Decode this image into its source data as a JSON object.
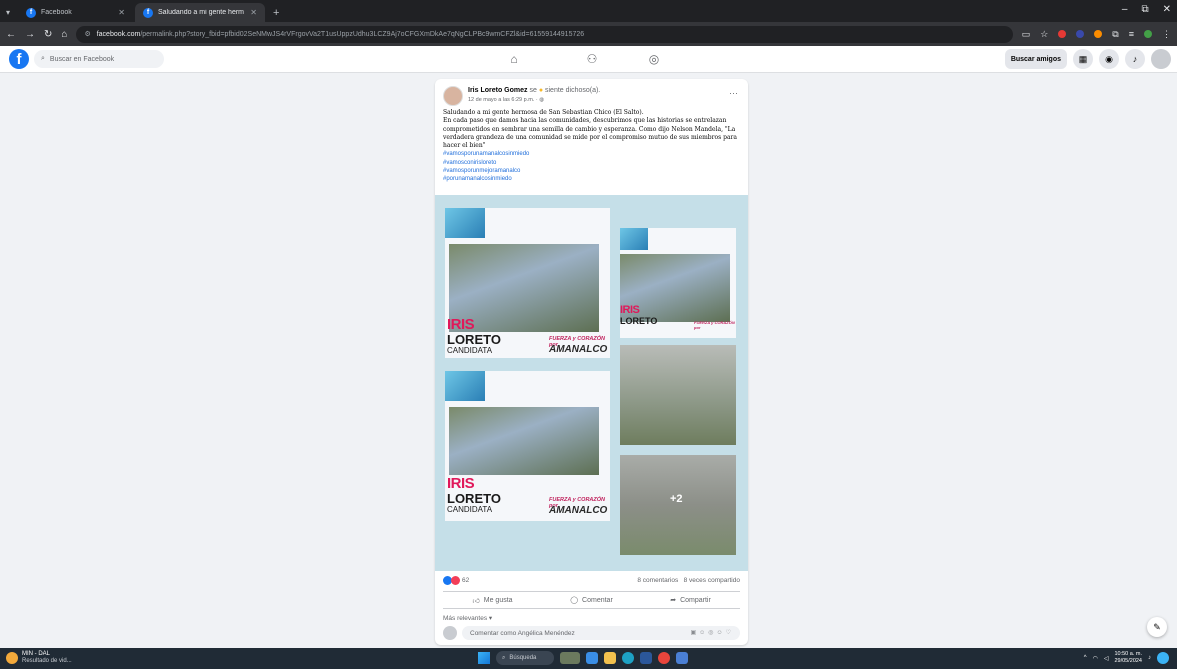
{
  "browser": {
    "tabs": [
      {
        "title": "Facebook",
        "active": false
      },
      {
        "title": "Saludando a mi gente herm",
        "active": true
      }
    ],
    "new_tab": "+",
    "url_host": "facebook.com",
    "url_path": "/permalink.php?story_fbid=pfbid02SeNMwJS4rVFrgovVa2T1usUppzUdhu3LCZ9Aj7oCFGXmDkAe7qNgCLPBc9wmCFZl&id=61559144915726",
    "window_controls": [
      "–",
      "⧉",
      "✕"
    ]
  },
  "facebook": {
    "logo": "f",
    "search_placeholder": "Buscar en Facebook",
    "nav_icons": [
      "home-icon",
      "friends-icon",
      "groups-icon"
    ],
    "find_friends": "Buscar amigos"
  },
  "post": {
    "author": "Iris Loreto Gomez",
    "feeling_prefix": " se ",
    "feeling": "siente dichoso(a).",
    "date": "12 de mayo a las 6:29 p.m. · ",
    "body": "Saludando a mi gente hermosa de San Sebastian Chico (El Salto).\nEn cada paso que damos hacia las comunidades, descubrimos que las historias se entrelazan comprometidos en sembrar una semilla de cambio y esperanza. Como dijo Nelson Mandela, \"La verdadera grandeza de una comunidad se mide por el compromiso mutuo de sus miembros para hacer el bien\"",
    "hashtags": [
      "#vamosporunamanalcosinmiedo",
      "#vamosconirisloreto",
      "#vamosporunmejoramanalco",
      "#porunamanalcosinmiedo"
    ],
    "image": {
      "iris": "IRIS",
      "loreto": "LORETO",
      "candidata": "CANDIDATA",
      "amanalco": "AMANALCO",
      "lema": "FUERZA y CORAZÓN por",
      "more_count": "+2"
    },
    "reactions_count": "62",
    "comments": "8 comentarios",
    "shares": "8 veces compartido",
    "actions": {
      "like": "Me gusta",
      "comment": "Comentar",
      "share": "Compartir"
    },
    "sort": "Más relevantes",
    "comment_placeholder": "Comentar como Angélica Menéndez"
  },
  "taskbar": {
    "weather_title": "MIN - DAL",
    "weather_sub": "Resultado de vid...",
    "search": "Búsqueda",
    "time": "10:50 a. m.",
    "date": "29/05/2024"
  },
  "colors": {
    "fb_blue": "#1877f2",
    "brand_pink": "#e0185a",
    "taskbar": "#202b36"
  }
}
